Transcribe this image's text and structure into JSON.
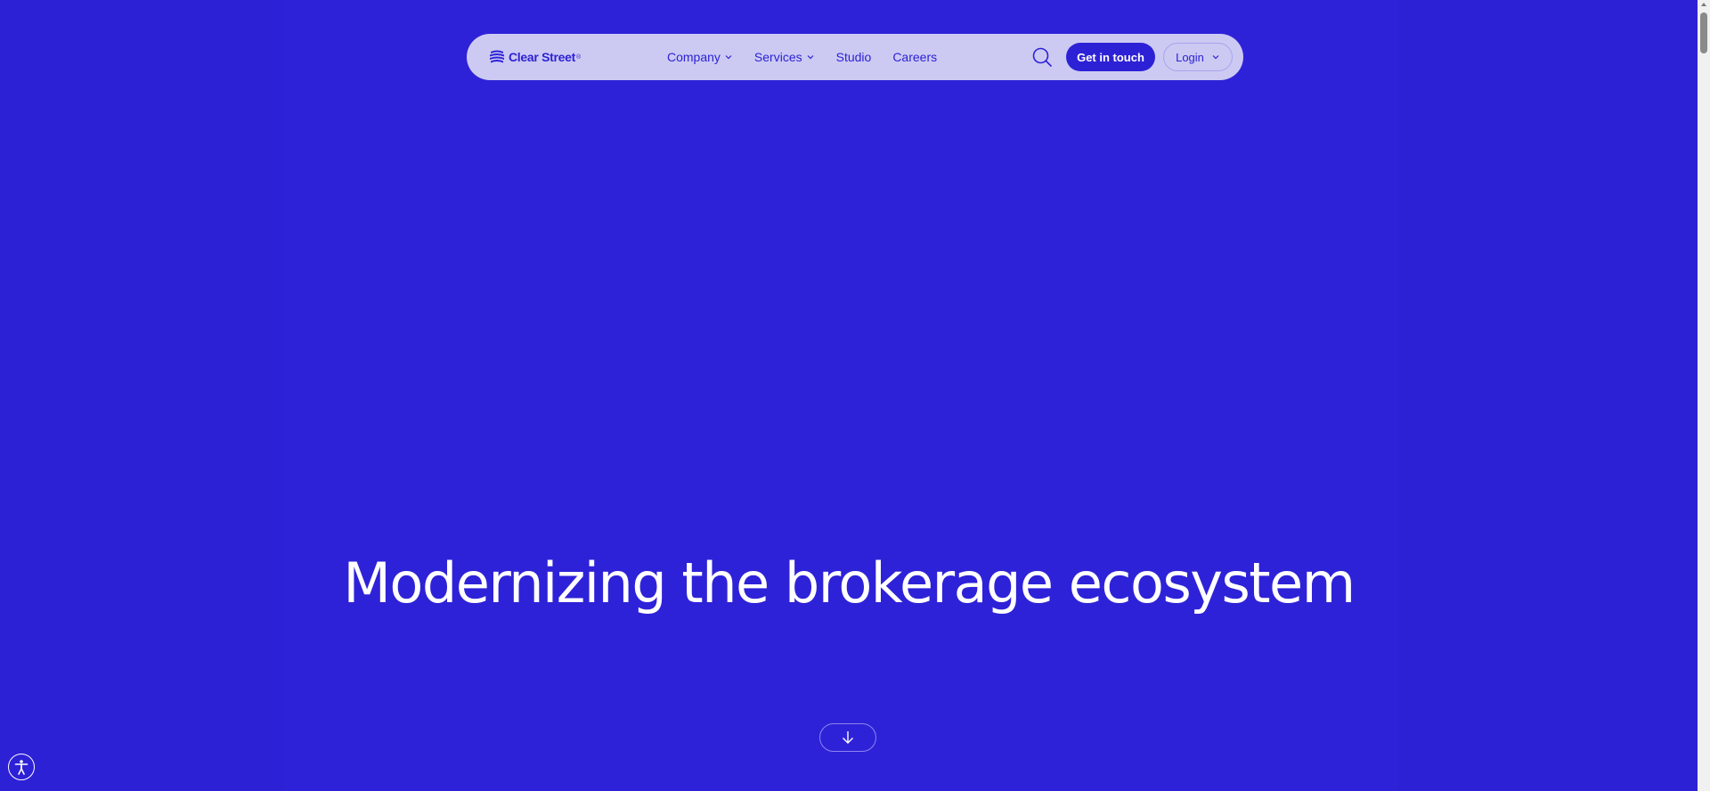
{
  "brand": {
    "name": "Clear Street",
    "registered": "®",
    "primary_color": "#2d21d6",
    "nav_bg_color": "#cccaf2"
  },
  "nav": {
    "items": [
      {
        "label": "Company",
        "has_dropdown": true
      },
      {
        "label": "Services",
        "has_dropdown": true
      },
      {
        "label": "Studio",
        "has_dropdown": false
      },
      {
        "label": "Careers",
        "has_dropdown": false
      }
    ],
    "search_icon": "search-icon",
    "cta_label": "Get in touch",
    "login_label": "Login"
  },
  "hero": {
    "headline": "Modernizing the brokerage ecosystem",
    "scroll_icon": "arrow-down-icon"
  },
  "accessibility": {
    "icon": "accessibility-icon"
  }
}
